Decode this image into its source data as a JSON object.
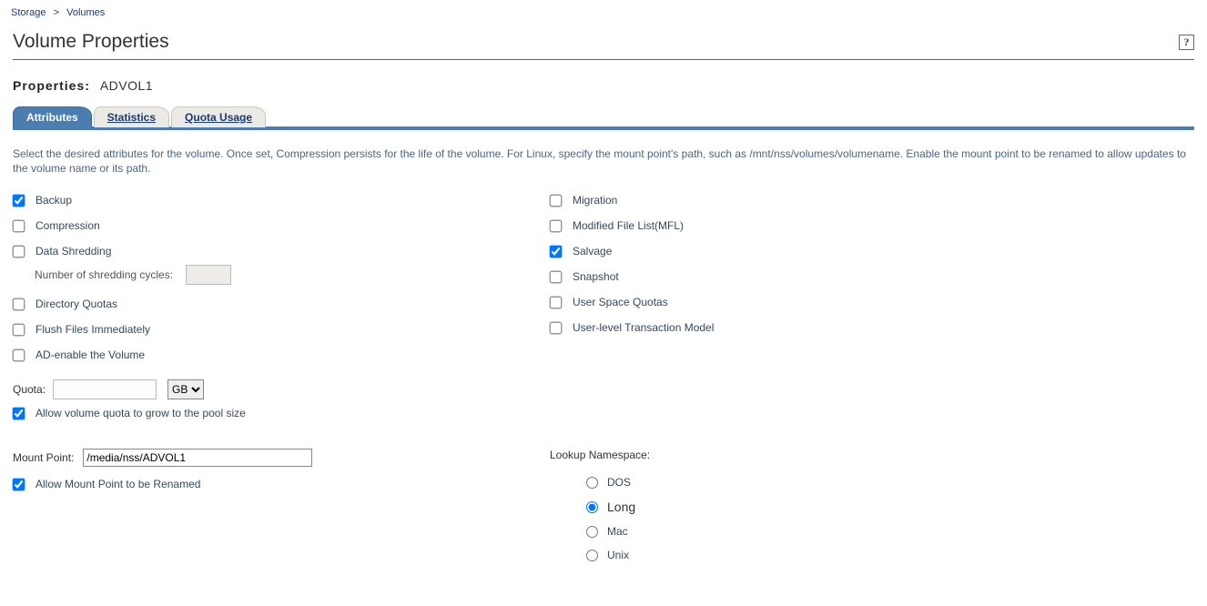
{
  "breadcrumb": {
    "item0": "Storage",
    "sep": ">",
    "item1": "Volumes"
  },
  "page_title": "Volume Properties",
  "help_glyph": "?",
  "properties": {
    "label": "Properties:",
    "value": "ADVOL1"
  },
  "tabs": {
    "attributes": "Attributes",
    "statistics": "Statistics",
    "quota_usage": "Quota Usage"
  },
  "instructions": "Select the desired attributes for the volume. Once set, Compression persists for the life of the volume. For Linux, specify the mount point's path, such as /mnt/nss/volumes/volumename. Enable the mount point to be renamed to allow updates to the volume name or its path.",
  "attrs_left": {
    "backup": {
      "label": "Backup",
      "checked": true
    },
    "compression": {
      "label": "Compression",
      "checked": false
    },
    "data_shredding": {
      "label": "Data Shredding",
      "checked": false
    },
    "shred_cycles_label": "Number of shredding cycles:",
    "shred_cycles_value": "",
    "dir_quotas": {
      "label": "Directory Quotas",
      "checked": false
    },
    "flush": {
      "label": "Flush Files Immediately",
      "checked": false
    },
    "ad_enable": {
      "label": "AD-enable the Volume",
      "checked": false
    }
  },
  "attrs_right": {
    "migration": {
      "label": "Migration",
      "checked": false
    },
    "mfl": {
      "label": "Modified File List(MFL)",
      "checked": false
    },
    "salvage": {
      "label": "Salvage",
      "checked": true
    },
    "snapshot": {
      "label": "Snapshot",
      "checked": false
    },
    "user_quotas": {
      "label": "User Space Quotas",
      "checked": false
    },
    "user_txn": {
      "label": "User-level Transaction Model",
      "checked": false
    }
  },
  "quota": {
    "label": "Quota:",
    "value": "",
    "unit": "GB",
    "allow_grow": {
      "label": "Allow volume quota to grow to the pool size",
      "checked": true
    }
  },
  "mount": {
    "label": "Mount Point:",
    "value": "/media/nss/ADVOL1",
    "allow_rename": {
      "label": "Allow Mount Point to be Renamed",
      "checked": true
    }
  },
  "namespace": {
    "label": "Lookup Namespace:",
    "options": {
      "dos": "DOS",
      "long": "Long",
      "mac": "Mac",
      "unix": "Unix"
    },
    "selected": "long"
  }
}
